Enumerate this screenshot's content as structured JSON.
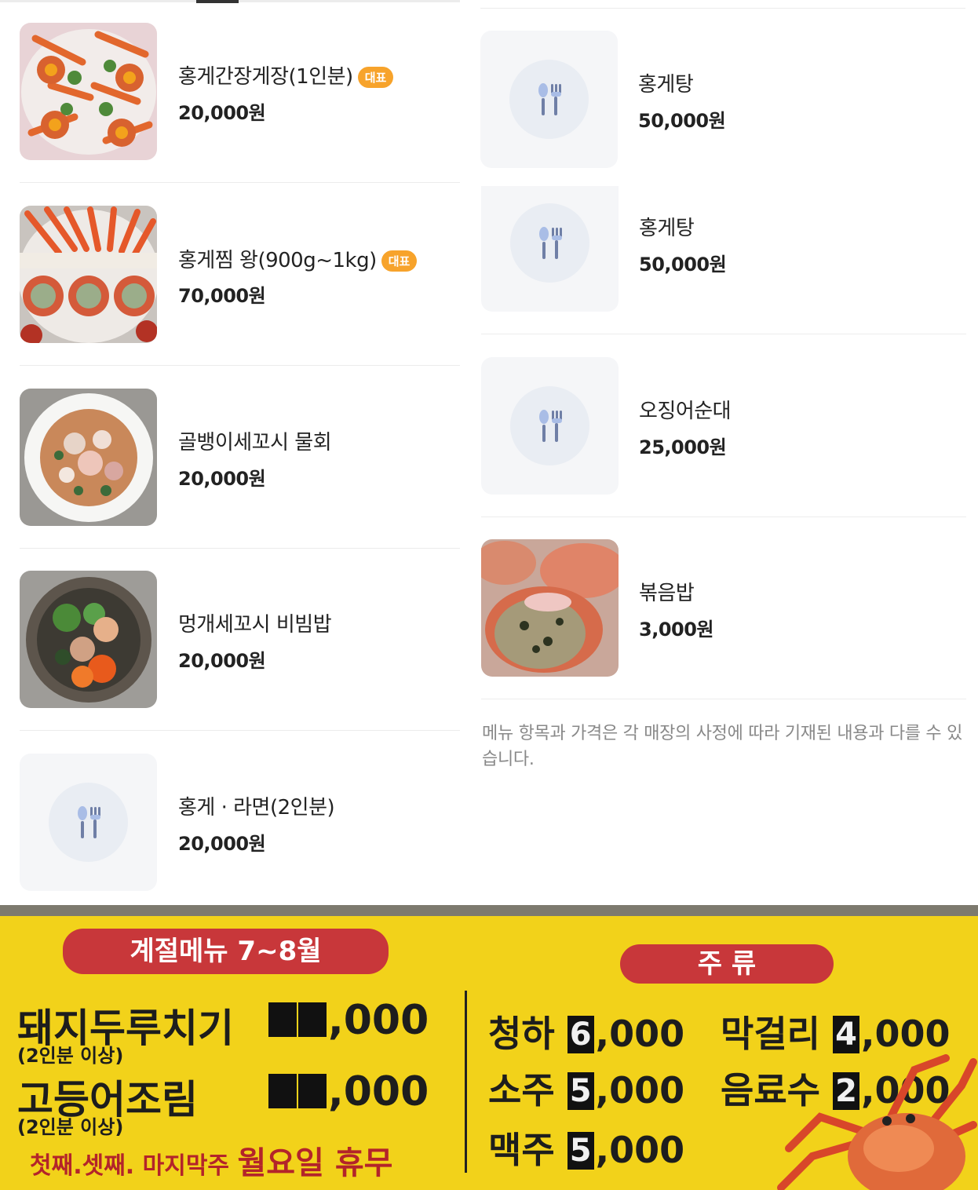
{
  "menu_left": [
    {
      "name": "홍게간장게장(1인분)",
      "badge": "대표",
      "price": "20,000원",
      "image": "crab-soy-photo"
    },
    {
      "name": "홍게찜 왕(900g~1kg)",
      "badge": "대표",
      "price": "70,000원",
      "image": "steamed-crab-photo"
    },
    {
      "name": "골뱅이세꼬시 물회",
      "badge": "",
      "price": "20,000원",
      "image": "mulhoe-photo"
    },
    {
      "name": "멍개세꼬시 비빔밥",
      "badge": "",
      "price": "20,000원",
      "image": "bibimbap-photo"
    },
    {
      "name": "홍게 · 라면(2인분)",
      "badge": "",
      "price": "20,000원",
      "image": "utensils-icon"
    }
  ],
  "menu_right": [
    {
      "name": "홍게탕",
      "price": "50,000원",
      "image": "utensils-icon"
    },
    {
      "name": "홍게탕",
      "price": "50,000원",
      "image": "utensils-icon"
    },
    {
      "name": "오징어순대",
      "price": "25,000원",
      "image": "utensils-icon"
    },
    {
      "name": "볶음밥",
      "price": "3,000원",
      "image": "fried-rice-photo"
    }
  ],
  "notice": "메뉴 항목과 가격은 각 매장의 사정에 따라 기재된 내용과 다를 수 있습니다.",
  "sign": {
    "seasonal_title": "계절메뉴 7~8월",
    "seasonal_items": [
      {
        "name": "돼지두루치기",
        "note": "(2인분 이상)",
        "price_suffix": ",000"
      },
      {
        "name": "고등어조림",
        "note": "(2인분 이상)",
        "price_suffix": ",000"
      }
    ],
    "closed_notice_prefix": "첫째.셋째. 마지막주",
    "closed_notice_day": "월요일 휴무",
    "drinks_title": "주 류",
    "drinks": [
      {
        "name": "청하",
        "digit": "6",
        "price_suffix": ",000"
      },
      {
        "name": "막걸리",
        "digit": "4",
        "price_suffix": ",000"
      },
      {
        "name": "소주",
        "digit": "5",
        "price_suffix": ",000"
      },
      {
        "name": "음료수",
        "digit": "2",
        "price_suffix": ",000"
      },
      {
        "name": "맥주",
        "digit": "5",
        "price_suffix": ",000"
      }
    ],
    "colors": {
      "background": "#f2d21a",
      "pill": "#c8373a",
      "badge": "#f7a32b"
    }
  }
}
